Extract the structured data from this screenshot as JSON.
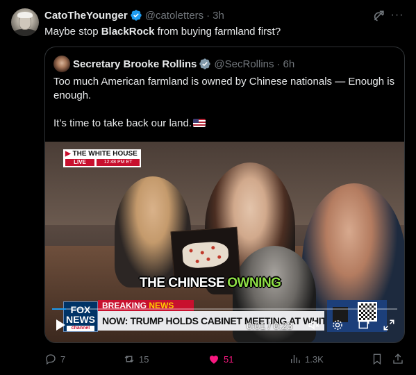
{
  "tweet": {
    "author_name": "CatoTheYounger",
    "handle": "@catoletters",
    "separator": "·",
    "time": "3h",
    "text_before": "Maybe stop ",
    "text_bold": "BlackRock",
    "text_after": " from buying farmland first?",
    "more_glyph": "···"
  },
  "quote": {
    "author_name": "Secretary Brooke Rollins",
    "handle": "@SecRollins",
    "separator": "·",
    "time": "6h",
    "paragraph1": "Too much American farmland is owned by Chinese nationals — Enough is enough.",
    "paragraph2": "It’s time to take back our land."
  },
  "video": {
    "tag_title": "THE WHITE HOUSE",
    "tag_arrow": "▶",
    "live_label": "LIVE",
    "tag_time": "12:48 PM ET",
    "caption_white": "THE CHINESE",
    "caption_green": "OWNING",
    "breaking_word1": "BREAKING",
    "breaking_word2": "NEWS",
    "network_logo_top": "FOX",
    "network_logo_bottom": "NEWS",
    "network_logo_channel": "channel",
    "headline": "NOW: TRUMP HOLDS CABINET MEETING AT WHITE HOUSE",
    "timecode": "0:01 / 0:23",
    "progress_fraction": 0.04
  },
  "actions": {
    "replies": "7",
    "reposts": "15",
    "likes": "51",
    "views": "1.3K"
  },
  "colors": {
    "accent": "#1d9bf0",
    "like": "#f91880",
    "muted": "#71767b",
    "text": "#e7e9ea",
    "caption_green": "#8fe046",
    "fox_red": "#c8102e"
  }
}
